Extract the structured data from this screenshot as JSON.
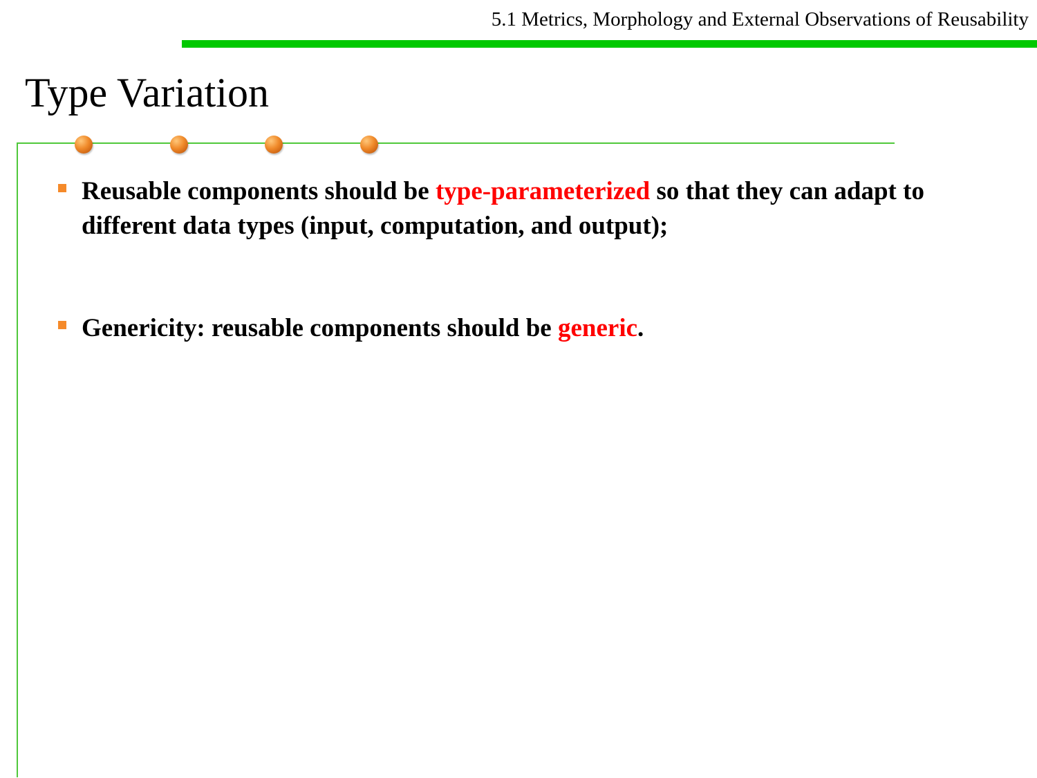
{
  "header": {
    "section_title": "5.1 Metrics, Morphology and External Observations of Reusability"
  },
  "slide": {
    "title": "Type Variation"
  },
  "bullets": [
    {
      "part1": "Reusable components should be ",
      "highlight": "type-parameterized",
      "part2": " so that they can adapt to different data types (input, computation, and output);"
    },
    {
      "part1": "Genericity: reusable components should be ",
      "highlight": "generic",
      "part2": "."
    }
  ],
  "colors": {
    "accent_green": "#00c800",
    "highlight_red": "#ff0000",
    "bullet_orange": "#f58a2a"
  }
}
